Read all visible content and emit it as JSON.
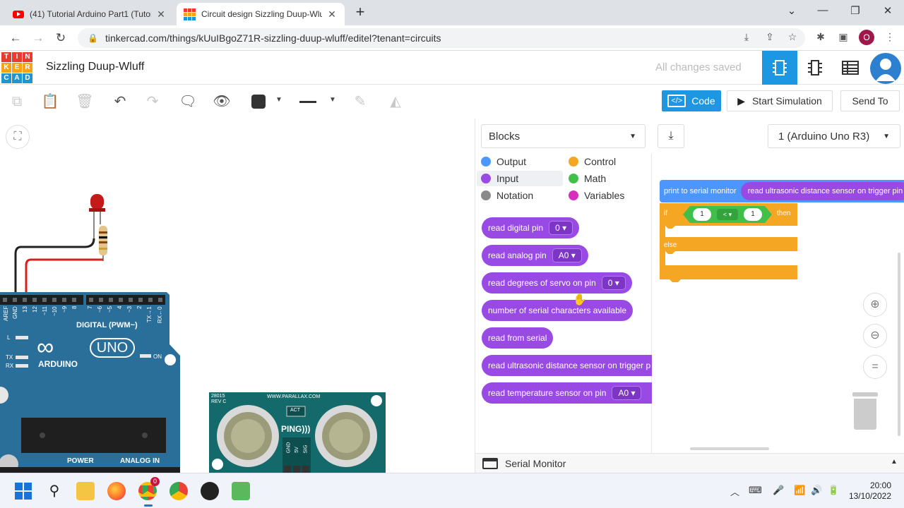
{
  "browser": {
    "tabs": [
      {
        "title": "(41) Tutorial Arduino Part1 (Tutori",
        "icon": "youtube-icon"
      },
      {
        "title": "Circuit design Sizzling Duup-Wlu",
        "icon": "tinkercad-icon"
      }
    ],
    "new_tab": "+",
    "url": "tinkercad.com/things/kUuIBgoZ71R-sizzling-duup-wluff/editel?tenant=circuits",
    "profile_initial": "O"
  },
  "app": {
    "logo_letters": [
      "T",
      "I",
      "N",
      "K",
      "E",
      "R",
      "C",
      "A",
      "D"
    ],
    "logo_colors": [
      "#e83c2c",
      "#e83c2c",
      "#e83c2c",
      "#f4a31b",
      "#f4a31b",
      "#f4a31b",
      "#1f96d4",
      "#1f96d4",
      "#1f96d4"
    ],
    "design_title": "Sizzling Duup-Wluff",
    "save_status": "All changes saved"
  },
  "toolbar": {
    "code_label": "Code",
    "start_simulation_label": "Start Simulation",
    "send_to_label": "Send To"
  },
  "code_panel": {
    "mode_select": "Blocks",
    "board_select": "1 (Arduino Uno R3)",
    "categories": [
      {
        "label": "Output",
        "color": "#4c97ff"
      },
      {
        "label": "Control",
        "color": "#f5a623"
      },
      {
        "label": "Input",
        "color": "#9a4ae4"
      },
      {
        "label": "Math",
        "color": "#40bf4a"
      },
      {
        "label": "Notation",
        "color": "#8a8a8a"
      },
      {
        "label": "Variables",
        "color": "#d62fbe"
      }
    ],
    "blocks": [
      {
        "label": "read digital pin",
        "dropdown": "0 ▾"
      },
      {
        "label": "read analog pin",
        "dropdown": "A0 ▾"
      },
      {
        "label": "read degrees of servo on pin",
        "dropdown": "0 ▾"
      },
      {
        "label": "number of serial characters available",
        "dropdown": ""
      },
      {
        "label": "read from serial",
        "dropdown": ""
      },
      {
        "label": "read ultrasonic distance sensor on trigger p",
        "dropdown": ""
      },
      {
        "label": "read temperature sensor on pin",
        "dropdown": "A0 ▾"
      }
    ],
    "workspace": {
      "print_block": "print to serial monitor",
      "print_arg": "read ultrasonic distance sensor on trigger pin",
      "if_label": "if",
      "then_label": "then",
      "else_label": "else",
      "left_operand": "1",
      "operator": "< ▾",
      "right_operand": "1"
    },
    "serial_monitor_label": "Serial Monitor"
  },
  "circuit": {
    "board_brand": "ARDUINO",
    "board_model": "UNO",
    "digital_label": "DIGITAL (PWM~)",
    "power_label": "POWER",
    "analog_label": "ANALOG IN",
    "on_label": "ON",
    "pin_labels": [
      "AREF",
      "GND",
      "13",
      "12",
      "~11",
      "~10",
      "~9",
      "8",
      "7",
      "~6",
      "~5",
      "4",
      "~3",
      "2",
      "TX→1",
      "RX←0"
    ],
    "side_labels": [
      "L",
      "TX",
      "RX"
    ],
    "sensor_top_text": "WWW.PARALLAX.COM",
    "sensor_id": "28015\nREV C",
    "sensor_brand": "PING)))",
    "sensor_act": "ACT",
    "sensor_pins": [
      "GND",
      "5V",
      "SIG"
    ]
  },
  "taskbar": {
    "time": "20:00",
    "date": "13/10/2022",
    "chrome_badge": "0"
  }
}
